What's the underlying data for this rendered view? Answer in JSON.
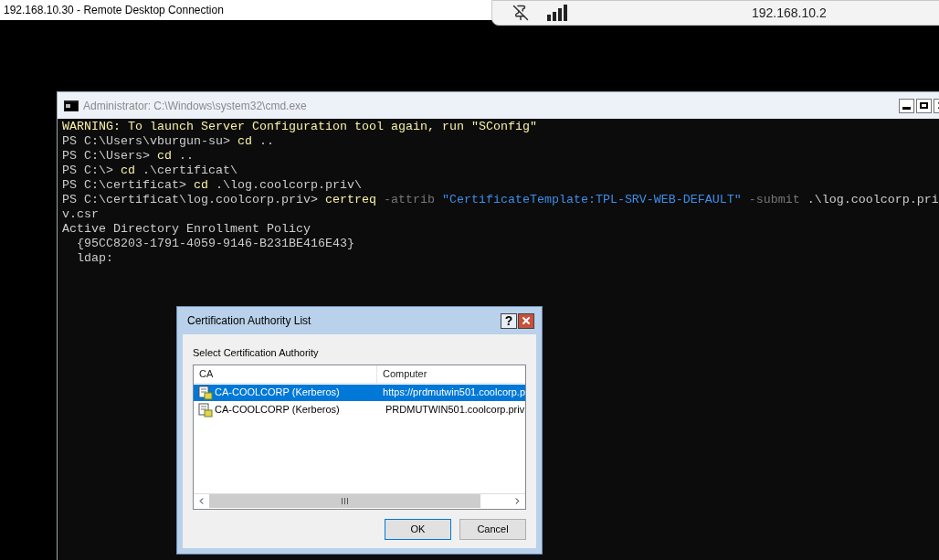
{
  "remote_desktop": {
    "title": "192.168.10.30 - Remote Desktop Connection"
  },
  "connection_bar": {
    "host": "192.168.10.2"
  },
  "console_window": {
    "title": "Administrator: C:\\Windows\\system32\\cmd.exe",
    "lines": [
      {
        "segments": [
          {
            "kind": "warning",
            "text": "WARNING: To launch Server Configuration tool again, run \"SConfig\""
          }
        ]
      },
      {
        "segments": [
          {
            "kind": "plain",
            "text": "PS C:\\Users\\vburgun-su> "
          },
          {
            "kind": "command",
            "text": "cd"
          },
          {
            "kind": "plain",
            "text": " .."
          }
        ]
      },
      {
        "segments": [
          {
            "kind": "plain",
            "text": "PS C:\\Users> "
          },
          {
            "kind": "command",
            "text": "cd"
          },
          {
            "kind": "plain",
            "text": " .."
          }
        ]
      },
      {
        "segments": [
          {
            "kind": "plain",
            "text": "PS C:\\> "
          },
          {
            "kind": "command",
            "text": "cd"
          },
          {
            "kind": "plain",
            "text": " .\\certificat\\"
          }
        ]
      },
      {
        "segments": [
          {
            "kind": "plain",
            "text": "PS C:\\certificat> "
          },
          {
            "kind": "command",
            "text": "cd"
          },
          {
            "kind": "plain",
            "text": " .\\log.coolcorp.priv\\"
          }
        ]
      },
      {
        "segments": [
          {
            "kind": "plain",
            "text": "PS C:\\certificat\\log.coolcorp.priv> "
          },
          {
            "kind": "command",
            "text": "certreq"
          },
          {
            "kind": "parameter",
            "text": " -attrib "
          },
          {
            "kind": "string",
            "text": "\"CertificateTemplate:TPL-SRV-WEB-DEFAULT\""
          },
          {
            "kind": "parameter",
            "text": " -submit"
          },
          {
            "kind": "plain",
            "text": " .\\log.coolcorp.pri"
          }
        ]
      },
      {
        "segments": [
          {
            "kind": "plain",
            "text": "v.csr"
          }
        ]
      },
      {
        "segments": [
          {
            "kind": "plain",
            "text": "Active Directory Enrollment Policy"
          }
        ]
      },
      {
        "segments": [
          {
            "kind": "plain",
            "text": "  {95CC8203-1791-4059-9146-B231BE416E43}"
          }
        ]
      },
      {
        "segments": [
          {
            "kind": "plain",
            "text": "  ldap:"
          }
        ]
      }
    ]
  },
  "dialog": {
    "title": "Certification Authority List",
    "help": "?",
    "prompt": "Select Certification Authority",
    "columns": [
      "CA",
      "Computer"
    ],
    "rows": [
      {
        "ca": "CA-COOLCORP (Kerberos)",
        "computer": "https://prdmutwin501.coolcorp.p",
        "selected": true
      },
      {
        "ca": "CA-COOLCORP (Kerberos)",
        "computer": "PRDMUTWIN501.coolcorp.priv",
        "selected": false
      }
    ],
    "buttons": [
      {
        "label": "OK",
        "default": true
      },
      {
        "label": "Cancel",
        "default": false
      }
    ]
  }
}
